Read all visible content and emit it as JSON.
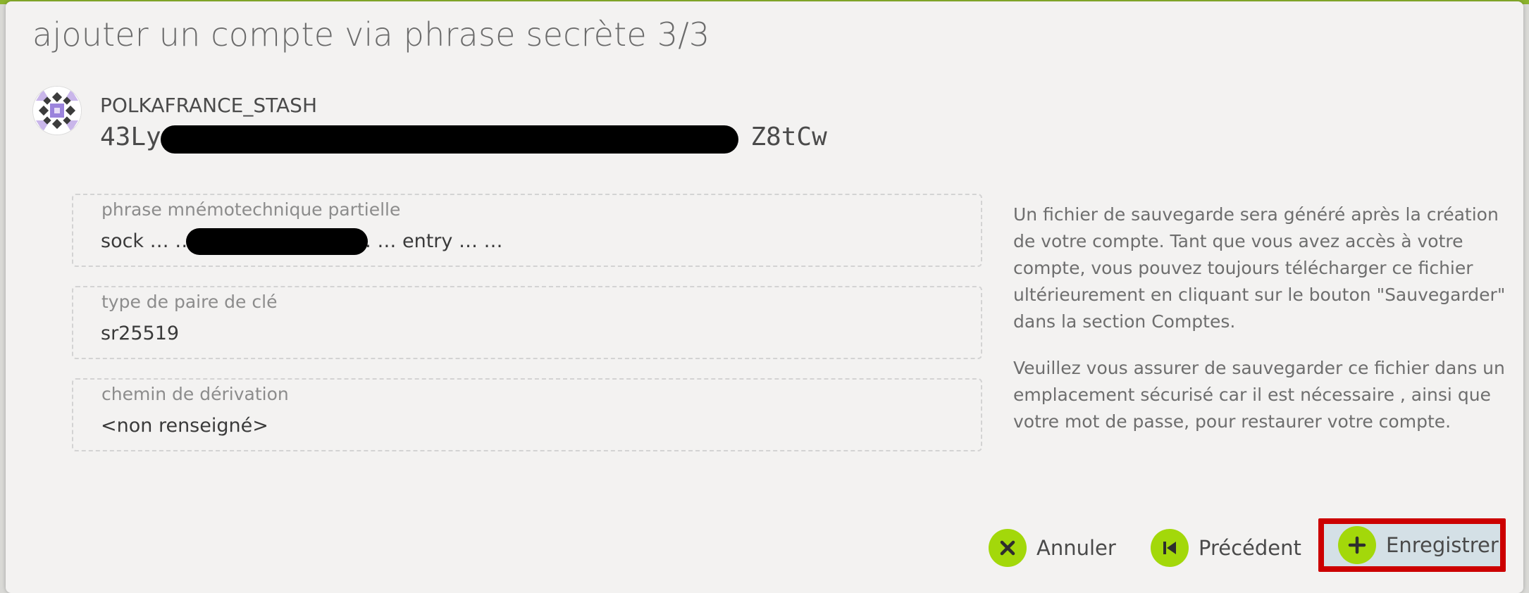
{
  "dialog": {
    "title": "ajouter un compte via phrase secrète 3/3"
  },
  "account": {
    "name": "POLKAFRANCE_STASH",
    "address_start": "43Lyd",
    "address_end": "Z8tCw",
    "identicon": "identicon"
  },
  "fields": {
    "mnemonic": {
      "label": "phrase mnémotechnique partielle",
      "value": "sock … … ……………………… … entry … …"
    },
    "keypair": {
      "label": "type de paire de clé",
      "value": "sr25519"
    },
    "derivation": {
      "label": "chemin de dérivation",
      "value": "<non renseigné>"
    }
  },
  "help": {
    "paragraph1": "Un fichier de sauvegarde sera généré après la création de votre compte. Tant que vous avez accès à votre compte, vous pouvez toujours télécharger ce fichier ultérieurement en cliquant sur le bouton \"Sauvegarder\" dans la section Comptes.",
    "paragraph2": "Veuillez vous assurer de sauvegarder ce fichier dans un emplacement sécurisé car il est nécessaire , ainsi que votre mot de passe, pour restaurer votre compte."
  },
  "buttons": {
    "cancel": {
      "label": "Annuler",
      "icon": "close-icon"
    },
    "previous": {
      "label": "Précédent",
      "icon": "step-backward-icon"
    },
    "save": {
      "label": "Enregistrer",
      "icon": "plus-icon"
    }
  },
  "colors": {
    "accent_bar": "#8bb32c",
    "button_icon": "#a3d80a",
    "highlight_border": "#cc0000",
    "save_background": "#d4e0e6"
  }
}
